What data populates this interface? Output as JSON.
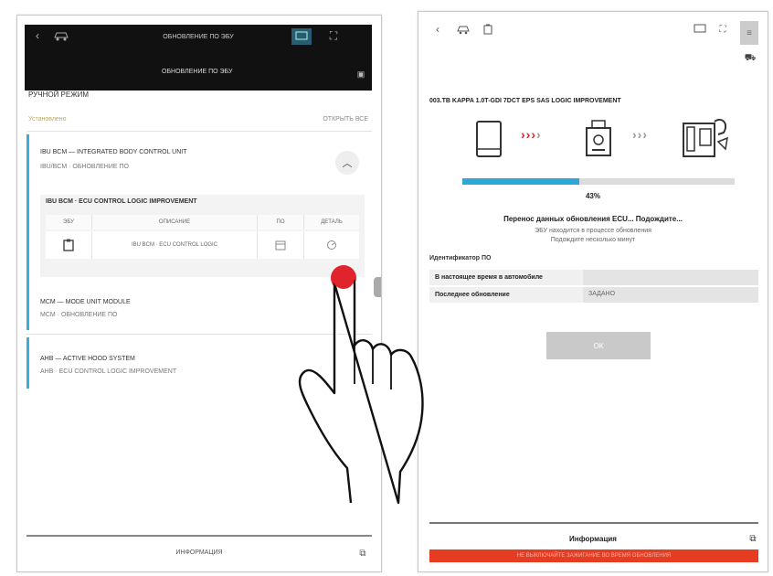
{
  "left": {
    "topbar": {
      "title": "ОБНОВЛЕНИЕ ПО ЭБУ",
      "subtitle": "ОБНОВЛЕНИЕ ПО ЭБУ",
      "back_icon": "chevron-left-icon",
      "car_icon": "car-icon",
      "device_icon": "device-icon",
      "fullscreen_icon": "fullscreen-icon"
    },
    "header": {
      "title": "РУЧНОЙ РЕЖИМ",
      "sub_left": "Установлено",
      "sub_mid": "",
      "sub_right": "ОТКРЫТЬ ВСЕ"
    },
    "cards": [
      {
        "title": "IBU BCM — INTEGRATED BODY CONTROL UNIT",
        "subtitle": "IBU/BCM · ОБНОВЛЕНИЕ ПО",
        "expanded": true,
        "table_title": "IBU BCM · ECU CONTROL LOGIC IMPROVEMENT",
        "columns": [
          "ЭБУ",
          "ОПИСАНИЕ",
          "ПО",
          "ДЕТАЛЬ"
        ],
        "row": [
          "",
          "IBU BCM · ECU CONTROL LOGIC",
          "",
          ""
        ]
      },
      {
        "title": "MCM — MODE UNIT MODULE",
        "subtitle": "MCM · ОБНОВЛЕНИЕ ПО"
      },
      {
        "title": "AHB — ACTIVE HOOD SYSTEM",
        "subtitle": "AHB · ECU CONTROL LOGIC IMPROVEMENT"
      }
    ],
    "footer_label": "ИНФОРМАЦИЯ"
  },
  "right": {
    "title": "003.TB KAPPA 1.0T-GDI 7DCT EPS SAS LOGIC IMPROVEMENT",
    "progress_percent": 43,
    "progress_text": "43%",
    "status": "Перенос данных обновления ECU... Подождите...",
    "note1": "ЭБУ находится в процессе обновления",
    "note2": "Подождите несколько минут",
    "section_title": "Идентификатор ПО",
    "info": [
      {
        "key": "В настоящее время в автомобиле",
        "value": ""
      },
      {
        "key": "Последнее обновление",
        "value": "ЗАДАНО"
      }
    ],
    "ok_label": "ОК",
    "footer_label": "Информация",
    "red_bar_text": "НЕ ВЫКЛЮЧАЙТЕ ЗАЖИГАНИЕ ВО ВРЕМЯ ОБНОВЛЕНИЯ"
  },
  "colors": {
    "accent": "#2da7d5",
    "alert": "#e63c22",
    "touch": "#e0242c",
    "arrow_red": "#e0242c",
    "arrow_grey": "#9a9a9a"
  }
}
